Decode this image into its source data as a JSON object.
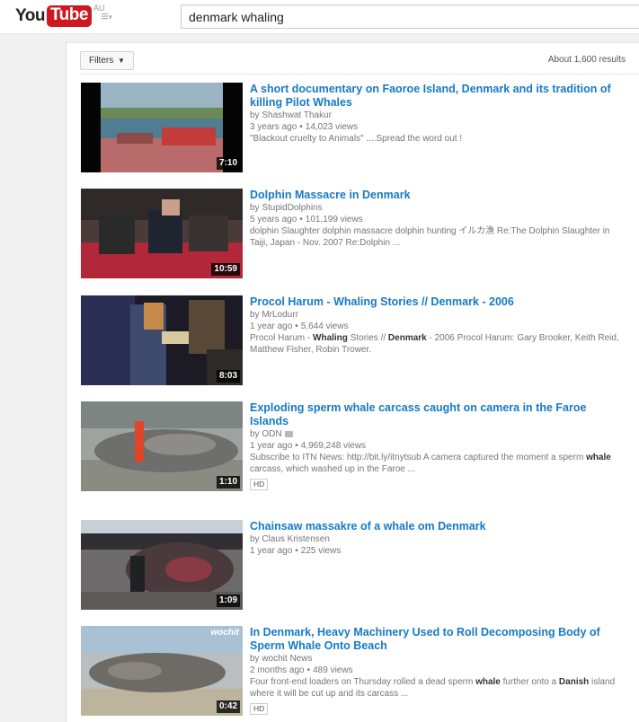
{
  "header": {
    "logo_you": "You",
    "logo_tube": "Tube",
    "logo_country": "AU",
    "search_query": "denmark whaling"
  },
  "toolbar": {
    "filters_label": "Filters",
    "results_count": "About 1,600 results"
  },
  "results": [
    {
      "title": "A short documentary on Faoroe Island, Denmark and its tradition of killing Pilot Whales",
      "channel": "by Shashwat Thakur",
      "age": "3 years ago",
      "views": "14,023 views",
      "description": "\"Blackout cruelty to Animals\" ....Spread the word out !",
      "duration": "7:10"
    },
    {
      "title": "Dolphin Massacre in Denmark",
      "channel": "by StupidDolphins",
      "age": "5 years ago",
      "views": "101,199 views",
      "description": "dolphin Slaughter dolphin massacre dolphin hunting イルカ漁 Re:The Dolphin Slaughter in Taiji, Japan - Nov. 2007 Re:Dolphin ...",
      "duration": "10:59"
    },
    {
      "title": "Procol Harum - Whaling Stories // Denmark - 2006",
      "channel": "by MrLodurr",
      "age": "1 year ago",
      "views": "5,644 views",
      "desc_parts": [
        "Procol Harum - ",
        "Whaling",
        " Stories // ",
        "Denmark",
        " - 2006 Procol Harum: Gary Brooker, Keith Reid, Matthew Fisher, Robin Trower."
      ],
      "duration": "8:03"
    },
    {
      "title": "Exploding sperm whale carcass caught on camera in the Faroe Islands",
      "channel": "by ODN",
      "age": "1 year ago",
      "views": "4,969,248 views",
      "desc_parts": [
        "Subscribe to ITN News: http://bit.ly/itnytsub A camera captured the moment a sperm ",
        "whale",
        " carcass, which washed up in the Faroe ..."
      ],
      "badge": "HD",
      "duration": "1:10"
    },
    {
      "title": "Chainsaw massakre of a whale om Denmark",
      "channel": "by Claus Kristensen",
      "age": "1 year ago",
      "views": "225 views",
      "duration": "1:09"
    },
    {
      "title": "In Denmark, Heavy Machinery Used to Roll Decomposing Body of Sperm Whale Onto Beach",
      "channel": "by wochit News",
      "age": "2 months ago",
      "views": "489 views",
      "desc_parts": [
        "Four front-end loaders on Thursday rolled a dead sperm ",
        "whale",
        " further onto a ",
        "Danish",
        " island where it will be cut up and its carcass ..."
      ],
      "badge": "HD",
      "watermark": "wochit",
      "duration": "0:42"
    }
  ],
  "separator_dot": "•",
  "colors": {
    "link": "#167ac6",
    "brand_red": "#cc181e"
  }
}
